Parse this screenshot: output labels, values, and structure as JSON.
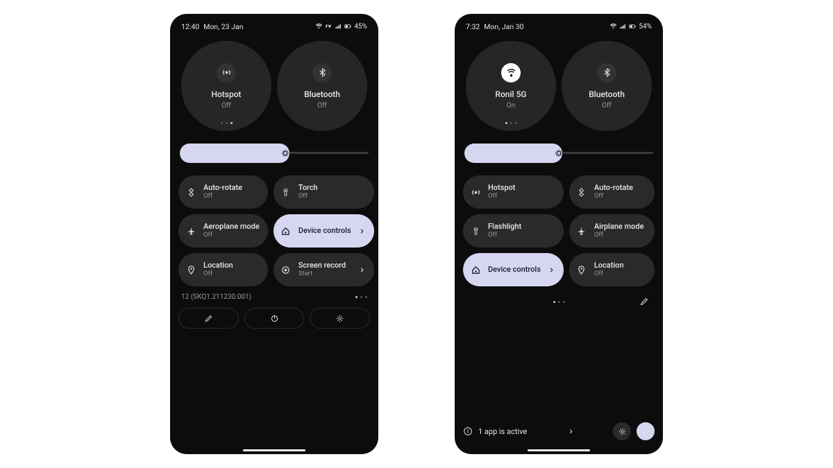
{
  "phone_left": {
    "status": {
      "time": "12:40",
      "date": "Mon, 23 Jan",
      "battery_text": "45%"
    },
    "big_tiles": [
      {
        "icon": "hotspot-icon",
        "label": "Hotspot",
        "sub": "Off",
        "active": false,
        "show_dots": true,
        "dot_active": 2
      },
      {
        "icon": "bluetooth-icon",
        "label": "Bluetooth",
        "sub": "Off",
        "active": false,
        "show_dots": false
      }
    ],
    "slider": {
      "fill_pct": 58
    },
    "tiles": [
      {
        "icon": "rotate-icon",
        "label": "Auto-rotate",
        "sub": "Off",
        "active": false,
        "chevron": false
      },
      {
        "icon": "torch-icon",
        "label": "Torch",
        "sub": "Off",
        "active": false,
        "chevron": false
      },
      {
        "icon": "airplane-icon",
        "label": "Aeroplane mode",
        "sub": "Off",
        "active": false,
        "chevron": false
      },
      {
        "icon": "home-icon",
        "label": "Device controls",
        "sub": "",
        "active": true,
        "chevron": true
      },
      {
        "icon": "location-icon",
        "label": "Location",
        "sub": "Off",
        "active": false,
        "chevron": false
      },
      {
        "icon": "record-icon",
        "label": "Screen record",
        "sub": "Start",
        "active": false,
        "chevron": true
      }
    ],
    "build_text": "12 (SKQ1.211230.001)",
    "page_dots": {
      "count": 3,
      "active": 0
    }
  },
  "phone_right": {
    "status": {
      "time": "7:32",
      "date": "Mon, Jan 30",
      "battery_text": "54%"
    },
    "big_tiles": [
      {
        "icon": "wifi-icon",
        "label": "Ronil 5G",
        "sub": "On",
        "active": true,
        "show_dots": true,
        "dot_active": 0
      },
      {
        "icon": "bluetooth-icon",
        "label": "Bluetooth",
        "sub": "Off",
        "active": false,
        "show_dots": false
      }
    ],
    "slider": {
      "fill_pct": 52
    },
    "tiles": [
      {
        "icon": "hotspot-icon",
        "label": "Hotspot",
        "sub": "Off",
        "active": false,
        "chevron": false
      },
      {
        "icon": "rotate-icon",
        "label": "Auto-rotate",
        "sub": "Off",
        "active": false,
        "chevron": false
      },
      {
        "icon": "torch-icon",
        "label": "Flashlight",
        "sub": "Off",
        "active": false,
        "chevron": false
      },
      {
        "icon": "airplane-icon",
        "label": "Airplane mode",
        "sub": "Off",
        "active": false,
        "chevron": false
      },
      {
        "icon": "home-icon",
        "label": "Device controls",
        "sub": "",
        "active": true,
        "chevron": true
      },
      {
        "icon": "location-icon",
        "label": "Location",
        "sub": "Off",
        "active": false,
        "chevron": false
      }
    ],
    "page_dots": {
      "count": 3,
      "active": 0
    },
    "bottom_text": "1 app is active"
  }
}
